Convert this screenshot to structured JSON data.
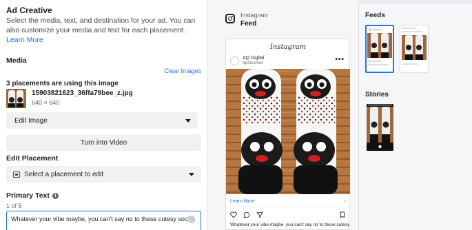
{
  "ad_creative": {
    "title": "Ad Creative",
    "description": "Select the media, text, and destination for your ad. You can also customize your media and text for each placement.",
    "learn_more": "Learn More"
  },
  "media": {
    "title": "Media",
    "clear_images": "Clear Images",
    "placements_note": "3 placements are using this image",
    "filename": "15903821623_36ffa79bee_z.jpg",
    "dimensions": "640 × 640",
    "edit_image_label": "Edit Image",
    "turn_into_video_label": "Turn into Video"
  },
  "edit_placement": {
    "title": "Edit Placement",
    "select_label": "Select a placement to edit"
  },
  "primary_text": {
    "title": "Primary Text",
    "count": "1 of 5",
    "value": "Whatever your vibe maybe, you can't say no to these cutesy socks."
  },
  "preview": {
    "platform": "Instagram",
    "placement": "Feed",
    "brand_text": "Instagram",
    "author": "AQ Digital",
    "sponsored": "Sponsored",
    "learn_more": "Learn More",
    "caption": "Whatever your vibe maybe, you can't say no to these cutesy"
  },
  "side": {
    "feeds_title": "Feeds",
    "stories_title": "Stories"
  },
  "colors": {
    "accent": "#216fdb",
    "selected": "#1877f2"
  }
}
